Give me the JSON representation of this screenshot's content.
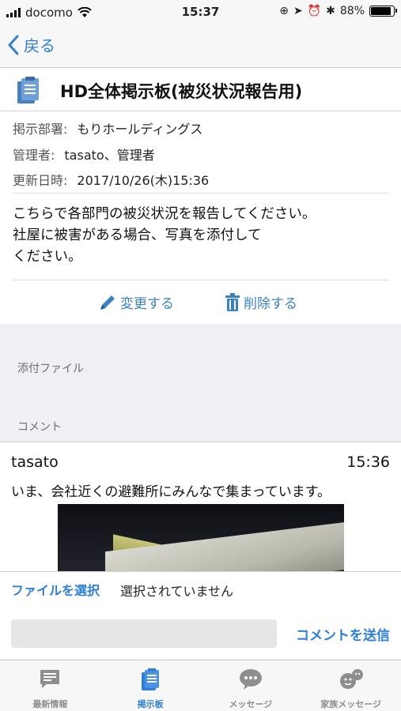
{
  "status": {
    "carrier": "docomo",
    "time": "15:37",
    "battery": "88%",
    "battery_level": 0.88
  },
  "nav": {
    "back_label": "戻る"
  },
  "board": {
    "title": "HD全体掲示板(被災状況報告用)",
    "icon": "clipboard-icon"
  },
  "meta": {
    "dept_label": "掲示部署:",
    "dept_value": "もりホールディングス",
    "admin_label": "管理者:",
    "admin_value": "tasato、管理者",
    "updated_label": "更新日時:",
    "updated_value": "2017/10/26(木)15:36"
  },
  "body": {
    "line1": "こちらで各部門の被災状況を報告してください。",
    "line2": "社屋に被害がある場合、写真を添付して",
    "line3": "ください。"
  },
  "actions": {
    "edit_label": "変更する",
    "delete_label": "削除する"
  },
  "sections": {
    "attachments_label": "添付ファイル",
    "comments_label": "コメント"
  },
  "comment": {
    "user": "tasato",
    "time": "15:36",
    "text": "いま、会社近くの避難所にみんなで集まっています。"
  },
  "file": {
    "choose_label": "ファイルを選択",
    "status": "選択されていません"
  },
  "comment_form": {
    "placeholder": "",
    "send_label": "コメントを送信"
  },
  "tabs": [
    {
      "label": "最新情報",
      "icon": "news-icon",
      "active": false
    },
    {
      "label": "掲示板",
      "icon": "clipboard-icon",
      "active": true
    },
    {
      "label": "メッセージ",
      "icon": "chat-bubble-icon",
      "active": false
    },
    {
      "label": "家族メッセージ",
      "icon": "family-chat-icon",
      "active": false
    }
  ],
  "colors": {
    "accent": "#2f7fd8",
    "action": "#3b82c4",
    "section_bg": "#efeff4"
  }
}
